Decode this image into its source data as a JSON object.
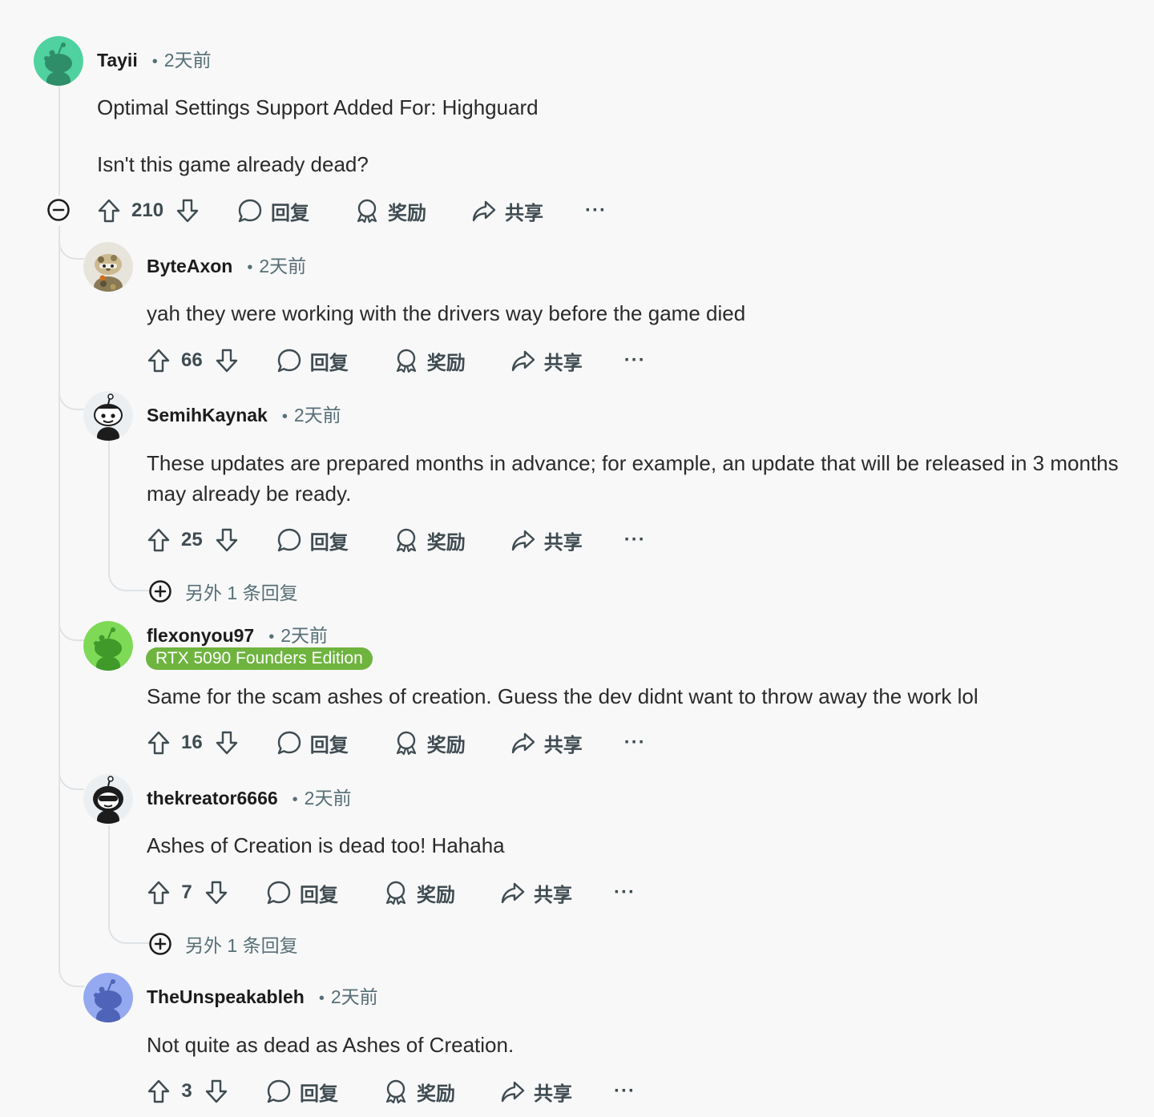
{
  "labels": {
    "reply": "回复",
    "award": "奖励",
    "share": "共享",
    "more": "···",
    "dot": "•"
  },
  "comments": [
    {
      "author": "Tayii",
      "time": "2天前",
      "paragraphs": [
        "Optimal Settings Support Added For: Highguard",
        "Isn't this game already dead?"
      ],
      "score": "210",
      "avatar": "green-snoo-avatar",
      "avatar_bg": "#4fd1a0"
    },
    {
      "author": "ByteAxon",
      "time": "2天前",
      "paragraphs": [
        "yah they were working with the drivers way before the game died"
      ],
      "score": "66",
      "avatar": "camo-snoo-avatar",
      "avatar_bg": "#e7e4dc"
    },
    {
      "author": "SemihKaynak",
      "time": "2天前",
      "paragraphs": [
        "These updates are prepared months in advance; for example, an update that will be released in 3 months may already be ready."
      ],
      "score": "25",
      "avatar": "white-snoo-avatar",
      "avatar_bg": "#eceff1",
      "more_replies": "另外 1 条回复"
    },
    {
      "author": "flexonyou97",
      "time": "2天前",
      "flair": "RTX 5090 Founders Edition",
      "paragraphs": [
        "Same for the scam ashes of creation. Guess the dev didnt want to throw away the work lol"
      ],
      "score": "16",
      "avatar": "lime-snoo-avatar",
      "avatar_bg": "#7ed957"
    },
    {
      "author": "thekreator6666",
      "time": "2天前",
      "paragraphs": [
        "Ashes of Creation is dead too! Hahaha"
      ],
      "score": "7",
      "avatar": "sunglasses-snoo-avatar",
      "avatar_bg": "#eceff1",
      "more_replies": "另外 1 条回复"
    },
    {
      "author": "TheUnspeakableh",
      "time": "2天前",
      "paragraphs": [
        "Not quite as dead as Ashes of Creation."
      ],
      "score": "3",
      "avatar": "blue-snoo-avatar",
      "avatar_bg": "#94a9f0"
    }
  ],
  "colors": {
    "flair": "#6eb43f",
    "thread_line": "#dfe3e6",
    "text_muted": "#576f76"
  }
}
